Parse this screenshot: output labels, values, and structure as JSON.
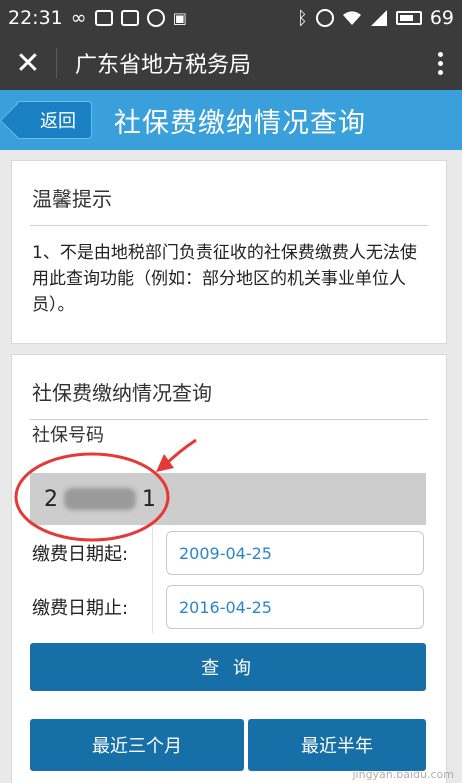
{
  "status_bar": {
    "time": "22:31",
    "battery_level": "69",
    "left_icons": [
      "infinity-icon",
      "image-icon",
      "notification-icon",
      "taobao-icon",
      "sim-icon"
    ],
    "right_icons": [
      "bluetooth-icon",
      "alarm-icon",
      "wifi-icon",
      "signal-4g-icon",
      "battery-icon"
    ]
  },
  "app_header": {
    "title": "广东省地方税务局",
    "close_icon": "close-icon",
    "more_icon": "more-vertical-icon"
  },
  "page_header": {
    "back_label": "返回",
    "title": "社保费缴纳情况查询"
  },
  "notice": {
    "title": "温馨提示",
    "text": "1、不是由地税部门负责征收的社保费缴费人无法使用此查询功能（例如：部分地区的机关事业单位人员）。"
  },
  "query": {
    "title": "社保费缴纳情况查询",
    "ssn_label": "社保号码",
    "ssn_value_start": "2",
    "ssn_value_end": "1",
    "start_date_label": "缴费日期起:",
    "start_date_value": "2009-04-25",
    "end_date_label": "缴费日期止:",
    "end_date_value": "2016-04-25",
    "submit_label": "查 询",
    "recent_3_months_label": "最近三个月",
    "recent_6_months_label": "最近半年"
  },
  "annotation_color": "#e53935",
  "accent_color": "#3aa0dc",
  "button_color": "#176fa8",
  "watermark": "jingyan.baidu.com"
}
